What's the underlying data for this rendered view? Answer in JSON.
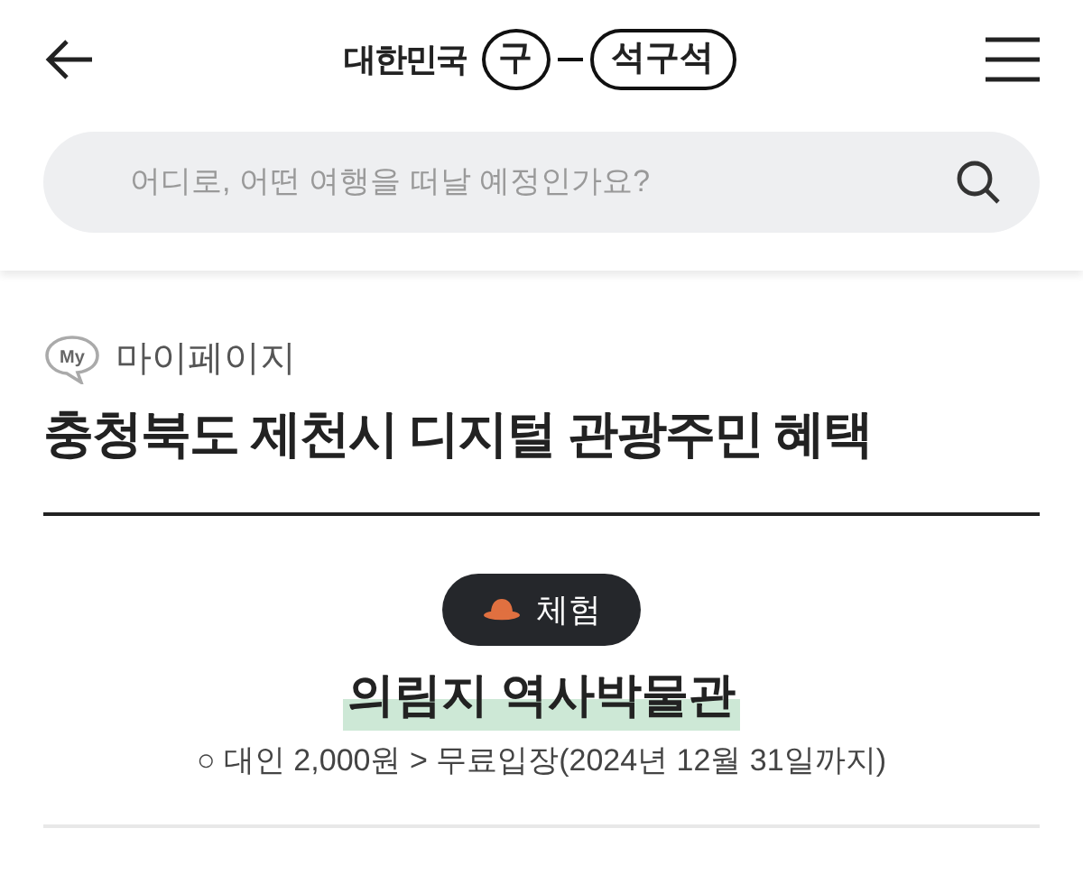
{
  "header": {
    "logo": {
      "prefix": "대한민국",
      "circle": "구",
      "pill": "석구석"
    }
  },
  "search": {
    "placeholder": "어디로, 어떤 여행을 떠날 예정인가요?"
  },
  "breadcrumb": {
    "badge": "My",
    "label": "마이페이지"
  },
  "page_title": "충청북도 제천시 디지털 관광주민 혜택",
  "benefit": {
    "category": "체험",
    "name": "의림지 역사박물관",
    "detail": "○ 대인 2,000원 > 무료입장(2024년 12월 31일까지)"
  }
}
